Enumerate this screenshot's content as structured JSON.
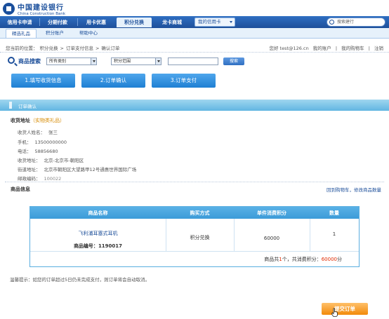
{
  "brand": {
    "cn": "中国建设银行",
    "en": "China Construction Bank"
  },
  "nav": {
    "items": [
      "信用卡申请",
      "分期付款",
      "用卡优惠",
      "积分兑换",
      "龙卡商城"
    ],
    "active_index": 3,
    "my_card": "我的信用卡",
    "search_placeholder": "搜索建行"
  },
  "subnav": {
    "items": [
      "精选礼品",
      "积分账户",
      "帮助中心"
    ],
    "active_index": 0
  },
  "breadcrumb": {
    "label": "您当前的位置：",
    "items": [
      "积分兑换",
      "订单支付信息",
      "确认订单"
    ],
    "separator": ">"
  },
  "user": {
    "greeting": "您好 test@126.cn",
    "links": [
      "我的账户",
      "我的购物车",
      "注销"
    ]
  },
  "search": {
    "title": "商品搜索",
    "category_value": "所有类别",
    "range_value": "积分范围",
    "third_value": "",
    "button": "搜索"
  },
  "steps": [
    "1.填写收货信息",
    "2.订单确认",
    "3.订单支付"
  ],
  "section_title": "订单确认",
  "address": {
    "title": "收货地址",
    "title_note": "（实物类礼品）",
    "fields": [
      {
        "label": "收货人姓名：",
        "value": "张三"
      },
      {
        "label": "手机：",
        "value": "13500000000"
      },
      {
        "label": "电话：",
        "value": "58856680"
      },
      {
        "label": "收货地址：",
        "value": "北京-北京市-朝阳区"
      },
      {
        "label": "街道地址：",
        "value": "北京市朝阳区大望路甲12号通惠世界国际广场"
      },
      {
        "label": "邮政编码：",
        "value": "100022"
      }
    ]
  },
  "product_info": {
    "title": "商品信息",
    "link": "回到购物车，修改商品数量",
    "headers": [
      "商品名称",
      "购买方式",
      "单件消费积分",
      "数量"
    ],
    "row": {
      "name": "飞利浦耳塞式耳机",
      "code_label": "商品编号：",
      "code": "1190017",
      "method": "积分兑换",
      "points": "60000",
      "quantity": "1"
    },
    "summary_prefix": "商品共",
    "summary_count": "1",
    "summary_mid": "个，共消费积分：",
    "summary_points": "60000",
    "summary_suffix": "分"
  },
  "tip": "温馨提示：如您的订单超过5日仍未完成支付，则订单将会自动取消。",
  "submit_button": "提交订单",
  "colors": {
    "brand_blue": "#1d4f9a",
    "step_blue": "#1f7fd3",
    "accent_orange": "#f28a0a",
    "points_red": "#e02a00"
  }
}
